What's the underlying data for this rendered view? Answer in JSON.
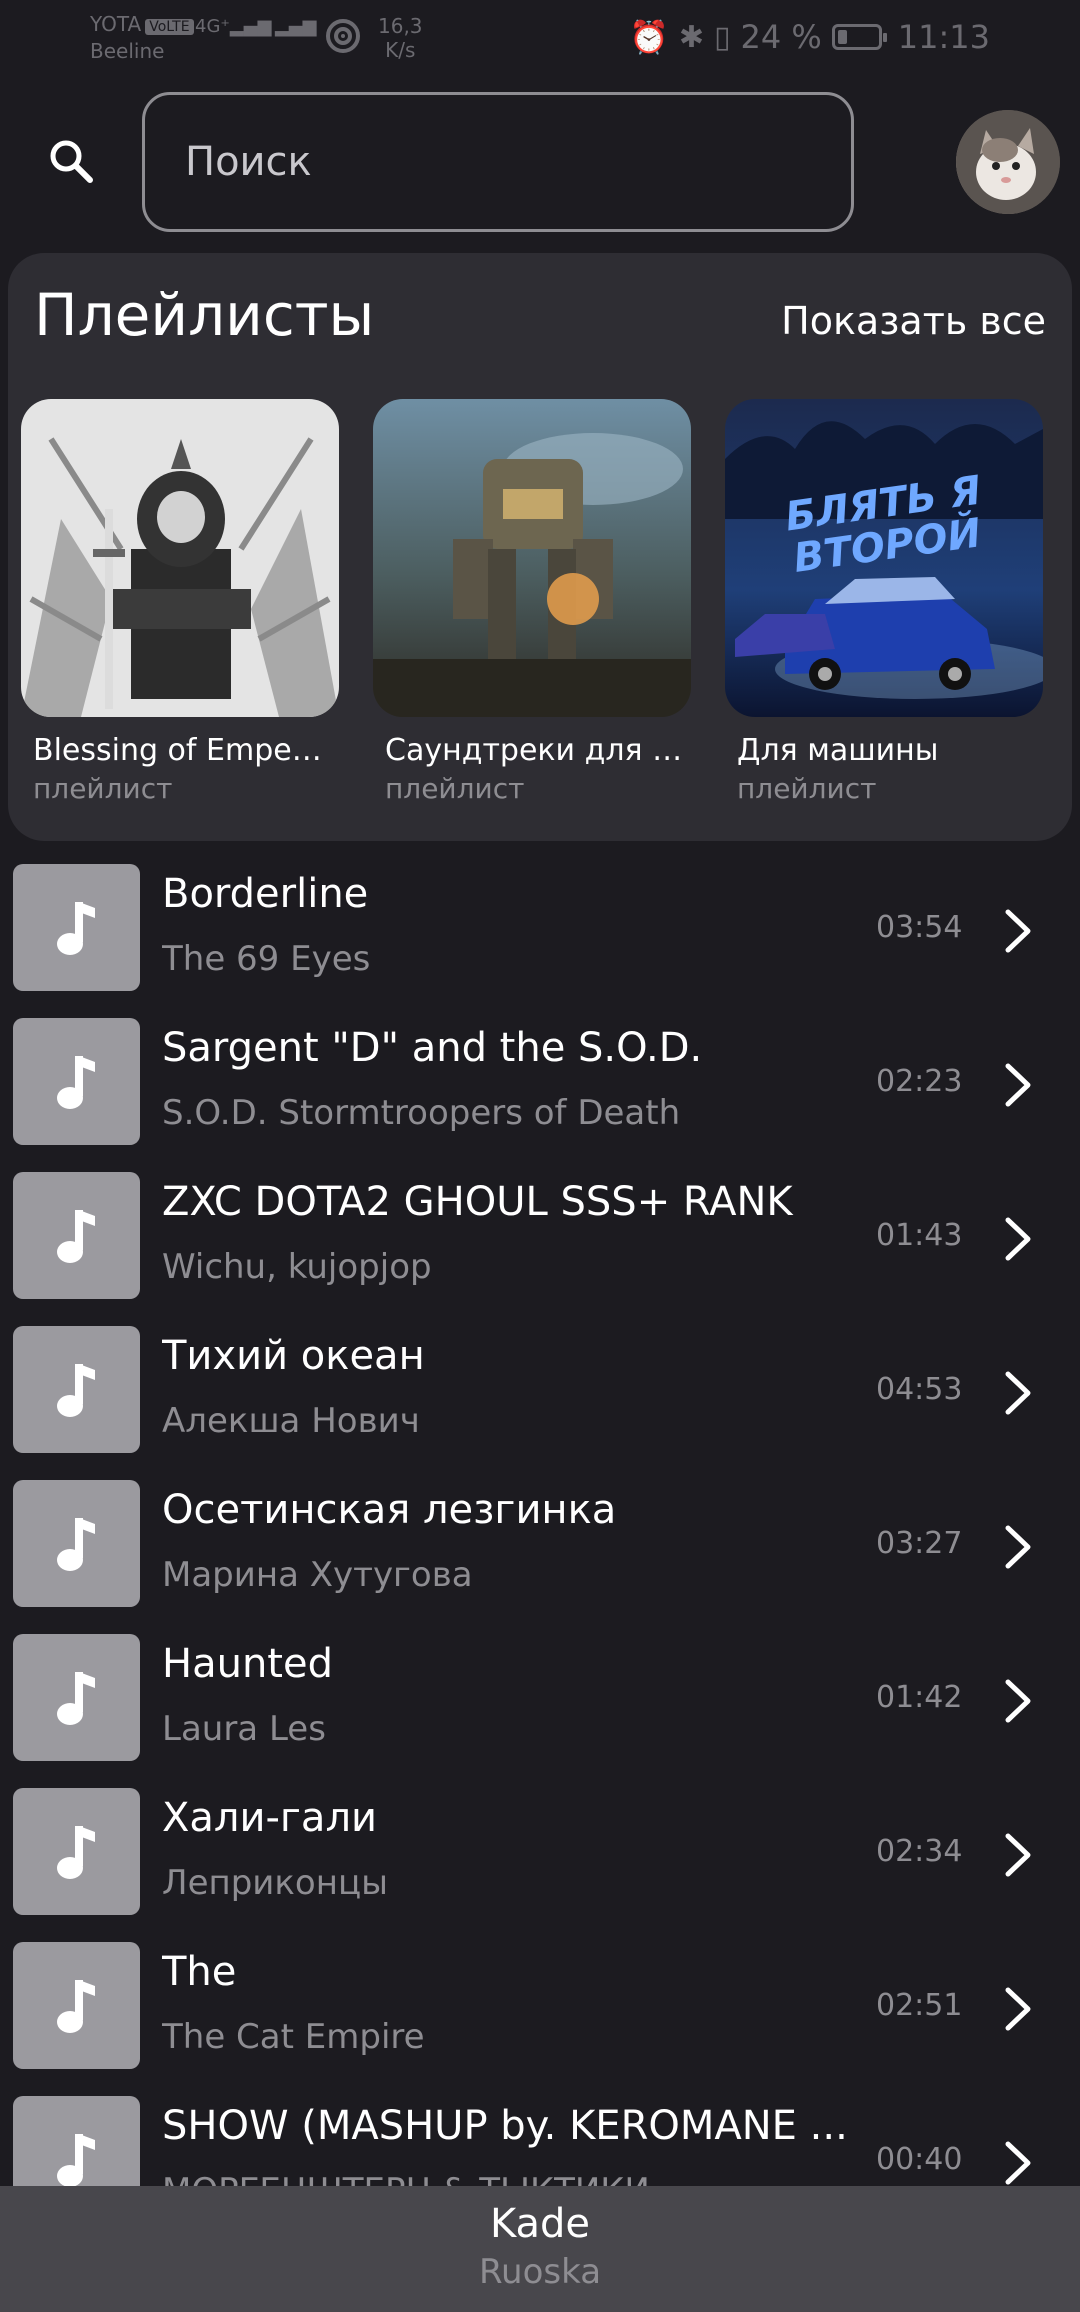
{
  "status_bar": {
    "carrier": "YOTA",
    "volte": "VoLTE",
    "carrier2": "Beeline",
    "network": "4G⁺",
    "speed_value": "16,3",
    "speed_unit": "K/s",
    "battery": "24 %",
    "battery_level": 0.24,
    "time": "11:13"
  },
  "search": {
    "placeholder": "Поиск"
  },
  "playlists": {
    "title": "Плейлисты",
    "show_all": "Показать все",
    "items": [
      {
        "name": "Blessing of Emperor",
        "type": "плейлист"
      },
      {
        "name": "Саундтреки для э...",
        "type": "плейлист"
      },
      {
        "name": "Для машины",
        "type": "плейлист",
        "cover_text": "БЛЯТЬ Я ВТОРОЙ"
      }
    ]
  },
  "tracks": [
    {
      "title": "Borderline",
      "artist": "The 69 Eyes",
      "duration": "03:54"
    },
    {
      "title": "Sargent \"D\" and the S.O.D.",
      "artist": "S.O.D. Stormtroopers of Death",
      "duration": "02:23"
    },
    {
      "title": "ZXC DOTA2 GHOUL SSS+ RANK",
      "artist": "Wichu, kujopjop",
      "duration": "01:43"
    },
    {
      "title": "Тихий океан",
      "artist": "Алекша Нович",
      "duration": "04:53"
    },
    {
      "title": "Осетинская лезгинка",
      "artist": "Марина Хутугова",
      "duration": "03:27"
    },
    {
      "title": "Haunted",
      "artist": "Laura Les",
      "duration": "01:42"
    },
    {
      "title": "Хали-гали",
      "artist": "Леприконцы",
      "duration": "02:34"
    },
    {
      "title": "The",
      "artist": "The Cat Empire",
      "duration": "02:51"
    },
    {
      "title": "SHOW (MASHUP by. KEROMANE ...",
      "artist": "МОРГЕНШТЕРН & ТЫКТИКИ",
      "duration": "00:40"
    }
  ],
  "now_playing": {
    "title": "Kade",
    "artist": "Ruoska"
  },
  "colors": {
    "background": "#1c1b20",
    "card": "#2e2d33",
    "secondary_text": "#8e8d92",
    "thumb": "#9b9a9f",
    "now_playing_bar": "#48474c"
  }
}
